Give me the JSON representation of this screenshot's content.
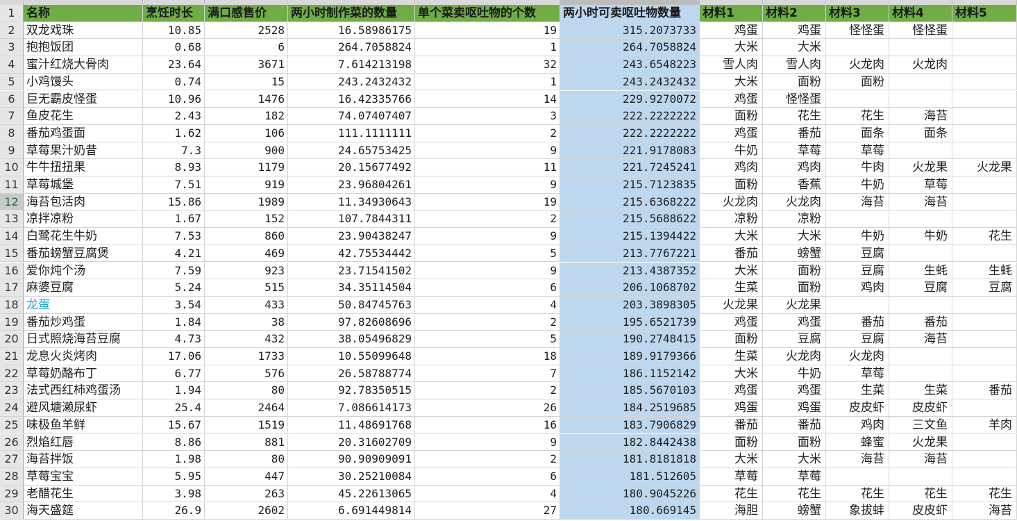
{
  "colors": {
    "header_bg": "#70ad47",
    "highlight_col": "#bdd7ee",
    "link_text": "#1fa3d4"
  },
  "headers": [
    "名称",
    "烹饪时长",
    "满口感售价",
    "两小时制作菜的数量",
    "单个菜卖呕吐物的个数",
    "两小时可卖呕吐物数量",
    "材料1",
    "材料2",
    "材料3",
    "材料4",
    "材料5"
  ],
  "rows": [
    {
      "n": "2",
      "c": [
        "双龙戏珠",
        "10.85",
        "2528",
        "16.58986175",
        "19",
        "315.2073733",
        "鸡蛋",
        "鸡蛋",
        "怪怪蛋",
        "怪怪蛋",
        ""
      ]
    },
    {
      "n": "3",
      "c": [
        "抱抱饭团",
        "0.68",
        "6",
        "264.7058824",
        "1",
        "264.7058824",
        "大米",
        "大米",
        "",
        "",
        ""
      ]
    },
    {
      "n": "4",
      "c": [
        "蜜汁红烧大骨肉",
        "23.64",
        "3671",
        "7.614213198",
        "32",
        "243.6548223",
        "雪人肉",
        "雪人肉",
        "火龙肉",
        "火龙肉",
        ""
      ]
    },
    {
      "n": "5",
      "c": [
        "小鸡馒头",
        "0.74",
        "15",
        "243.2432432",
        "1",
        "243.2432432",
        "大米",
        "面粉",
        "面粉",
        "",
        ""
      ]
    },
    {
      "n": "6",
      "c": [
        "巨无霸皮怪蛋",
        "10.96",
        "1476",
        "16.42335766",
        "14",
        "229.9270072",
        "鸡蛋",
        "怪怪蛋",
        "",
        "",
        ""
      ]
    },
    {
      "n": "7",
      "c": [
        "鱼皮花生",
        "2.43",
        "182",
        "74.07407407",
        "3",
        "222.2222222",
        "面粉",
        "花生",
        "花生",
        "海苔",
        ""
      ]
    },
    {
      "n": "8",
      "c": [
        "番茄鸡蛋面",
        "1.62",
        "106",
        "111.1111111",
        "2",
        "222.2222222",
        "鸡蛋",
        "番茄",
        "面条",
        "面条",
        ""
      ]
    },
    {
      "n": "9",
      "c": [
        "草莓果汁奶昔",
        "7.3",
        "900",
        "24.65753425",
        "9",
        "221.9178083",
        "牛奶",
        "草莓",
        "草莓",
        "",
        ""
      ]
    },
    {
      "n": "10",
      "c": [
        "牛牛扭扭果",
        "8.93",
        "1179",
        "20.15677492",
        "11",
        "221.7245241",
        "鸡肉",
        "鸡肉",
        "牛肉",
        "火龙果",
        "火龙果"
      ]
    },
    {
      "n": "11",
      "c": [
        "草莓城堡",
        "7.51",
        "919",
        "23.96804261",
        "9",
        "215.7123835",
        "面粉",
        "香蕉",
        "牛奶",
        "草莓",
        ""
      ]
    },
    {
      "n": "12",
      "c": [
        "海苔包活肉",
        "15.86",
        "1989",
        "11.34930643",
        "19",
        "215.6368222",
        "火龙肉",
        "火龙肉",
        "海苔",
        "海苔",
        ""
      ]
    },
    {
      "n": "13",
      "c": [
        "凉拌凉粉",
        "1.67",
        "152",
        "107.7844311",
        "2",
        "215.5688622",
        "凉粉",
        "凉粉",
        "",
        "",
        ""
      ]
    },
    {
      "n": "14",
      "c": [
        "白鹭花生牛奶",
        "7.53",
        "860",
        "23.90438247",
        "9",
        "215.1394422",
        "大米",
        "大米",
        "牛奶",
        "牛奶",
        "花生"
      ]
    },
    {
      "n": "15",
      "c": [
        "番茄螃蟹豆腐煲",
        "4.21",
        "469",
        "42.75534442",
        "5",
        "213.7767221",
        "番茄",
        "螃蟹",
        "豆腐",
        "",
        ""
      ]
    },
    {
      "n": "16",
      "c": [
        "爱你炖个汤",
        "7.59",
        "923",
        "23.71541502",
        "9",
        "213.4387352",
        "大米",
        "面粉",
        "豆腐",
        "生蚝",
        "生蚝"
      ]
    },
    {
      "n": "17",
      "c": [
        "麻婆豆腐",
        "5.24",
        "515",
        "34.35114504",
        "6",
        "206.1068702",
        "生菜",
        "面粉",
        "鸡肉",
        "豆腐",
        "豆腐"
      ]
    },
    {
      "n": "18",
      "c": [
        "龙蛋",
        "3.54",
        "433",
        "50.84745763",
        "4",
        "203.3898305",
        "火龙果",
        "火龙果",
        "",
        "",
        ""
      ]
    },
    {
      "n": "19",
      "c": [
        "番茄炒鸡蛋",
        "1.84",
        "38",
        "97.82608696",
        "2",
        "195.6521739",
        "鸡蛋",
        "鸡蛋",
        "番茄",
        "番茄",
        ""
      ]
    },
    {
      "n": "20",
      "c": [
        "日式照烧海苔豆腐",
        "4.73",
        "432",
        "38.05496829",
        "5",
        "190.2748415",
        "面粉",
        "豆腐",
        "豆腐",
        "海苔",
        ""
      ]
    },
    {
      "n": "21",
      "c": [
        "龙息火炎烤肉",
        "17.06",
        "1733",
        "10.55099648",
        "18",
        "189.9179366",
        "生菜",
        "火龙肉",
        "火龙肉",
        "",
        ""
      ]
    },
    {
      "n": "22",
      "c": [
        "草莓奶酪布丁",
        "6.77",
        "576",
        "26.58788774",
        "7",
        "186.1152142",
        "大米",
        "牛奶",
        "草莓",
        "",
        ""
      ]
    },
    {
      "n": "23",
      "c": [
        "法式西红柿鸡蛋汤",
        "1.94",
        "80",
        "92.78350515",
        "2",
        "185.5670103",
        "鸡蛋",
        "鸡蛋",
        "生菜",
        "生菜",
        "番茄"
      ]
    },
    {
      "n": "24",
      "c": [
        "避风塘濑尿虾",
        "25.4",
        "2464",
        "7.086614173",
        "26",
        "184.2519685",
        "鸡蛋",
        "鸡蛋",
        "皮皮虾",
        "皮皮虾",
        ""
      ]
    },
    {
      "n": "25",
      "c": [
        "味极鱼羊鲜",
        "15.67",
        "1519",
        "11.48691768",
        "16",
        "183.7906829",
        "番茄",
        "番茄",
        "鸡肉",
        "三文鱼",
        "羊肉"
      ]
    },
    {
      "n": "26",
      "c": [
        "烈焰红唇",
        "8.86",
        "881",
        "20.31602709",
        "9",
        "182.8442438",
        "面粉",
        "面粉",
        "蜂蜜",
        "火龙果",
        ""
      ]
    },
    {
      "n": "27",
      "c": [
        "海苔拌饭",
        "1.98",
        "80",
        "90.90909091",
        "2",
        "181.8181818",
        "大米",
        "大米",
        "海苔",
        "海苔",
        ""
      ]
    },
    {
      "n": "28",
      "c": [
        "草莓宝宝",
        "5.95",
        "447",
        "30.25210084",
        "6",
        "181.512605",
        "草莓",
        "草莓",
        "",
        "",
        ""
      ]
    },
    {
      "n": "29",
      "c": [
        "老醋花生",
        "3.98",
        "263",
        "45.22613065",
        "4",
        "180.9045226",
        "花生",
        "花生",
        "花生",
        "花生",
        "花生"
      ]
    },
    {
      "n": "30",
      "c": [
        "海天盛筵",
        "26.9",
        "2602",
        "6.691449814",
        "27",
        "180.669145",
        "海胆",
        "螃蟹",
        "象拔蚌",
        "皮皮虾",
        "海苔"
      ]
    }
  ]
}
